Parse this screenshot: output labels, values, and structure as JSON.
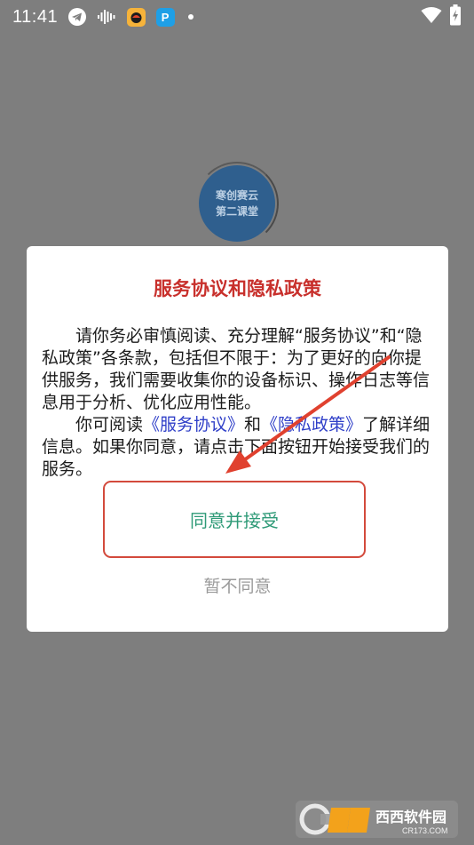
{
  "status_bar": {
    "time": "11:41",
    "icons": [
      "telegram-icon",
      "audio-wave-icon",
      "game-app-icon",
      "p-app-icon",
      "notification-dot-icon",
      "wifi-icon",
      "battery-charging-icon"
    ],
    "p_app_letter": "P"
  },
  "background_app": {
    "logo_line1": "寒创赛云",
    "logo_line2": "第二课堂"
  },
  "dialog": {
    "title": "服务协议和隐私政策",
    "paragraph1": "请你务必审慎阅读、充分理解“服务协议”和“隐私政策”各条款，包括但不限于：为了更好的向你提供服务，我们需要收集你的设备标识、操作日志等信息用于分析、优化应用性能。",
    "paragraph2_prefix": "你可阅读",
    "service_link": "《服务协议》",
    "paragraph2_and": "和",
    "privacy_link": "《隐私政策》",
    "paragraph2_suffix": "了解详细信息。如果你同意，请点击下面按钮开始接受我们的服务。",
    "agree_button": "同意并接受",
    "disagree_button": "暂不同意"
  },
  "annotation": {
    "arrow_color": "#e0412f",
    "highlight_color": "#d34a3c"
  },
  "watermark": {
    "brand": "西西软件园",
    "site": "CR173.COM"
  }
}
